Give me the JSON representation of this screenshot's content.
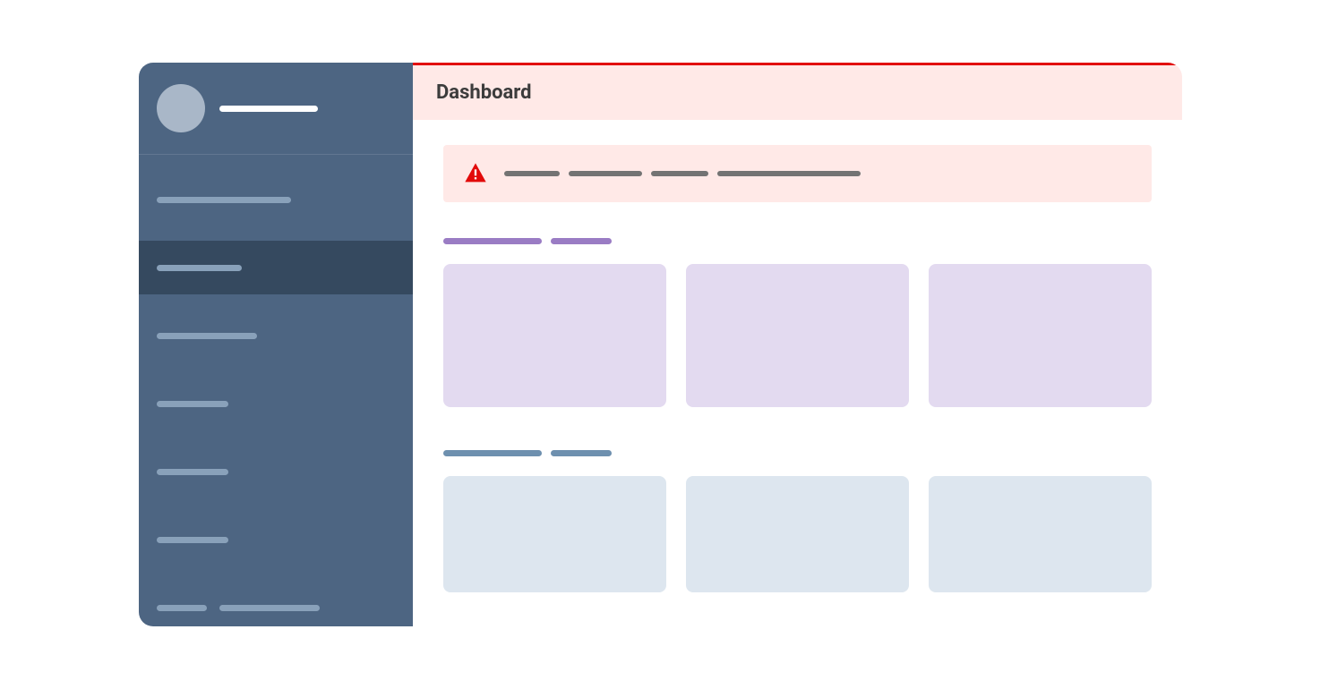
{
  "header": {
    "title": "Dashboard"
  },
  "sidebar": {
    "username_placeholder": "",
    "items": [
      {
        "label": "",
        "active": false
      },
      {
        "label": "",
        "active": true
      },
      {
        "label": "",
        "active": false
      },
      {
        "label": "",
        "active": false
      },
      {
        "label": "",
        "active": false
      },
      {
        "label": "",
        "active": false
      },
      {
        "label": "",
        "active": false
      }
    ]
  },
  "alert": {
    "message_placeholder": ""
  },
  "sections": [
    {
      "color": "purple",
      "heading_placeholder": "",
      "cards": [
        "",
        "",
        ""
      ]
    },
    {
      "color": "blue",
      "heading_placeholder": "",
      "cards": [
        "",
        "",
        ""
      ]
    }
  ],
  "colors": {
    "sidebar_bg": "#4d6582",
    "sidebar_active": "#35495f",
    "alert_bar": "#e20a0a",
    "alert_bg": "#ffe9e7",
    "purple_card": "#e3daf0",
    "blue_card": "#dde6ef"
  }
}
